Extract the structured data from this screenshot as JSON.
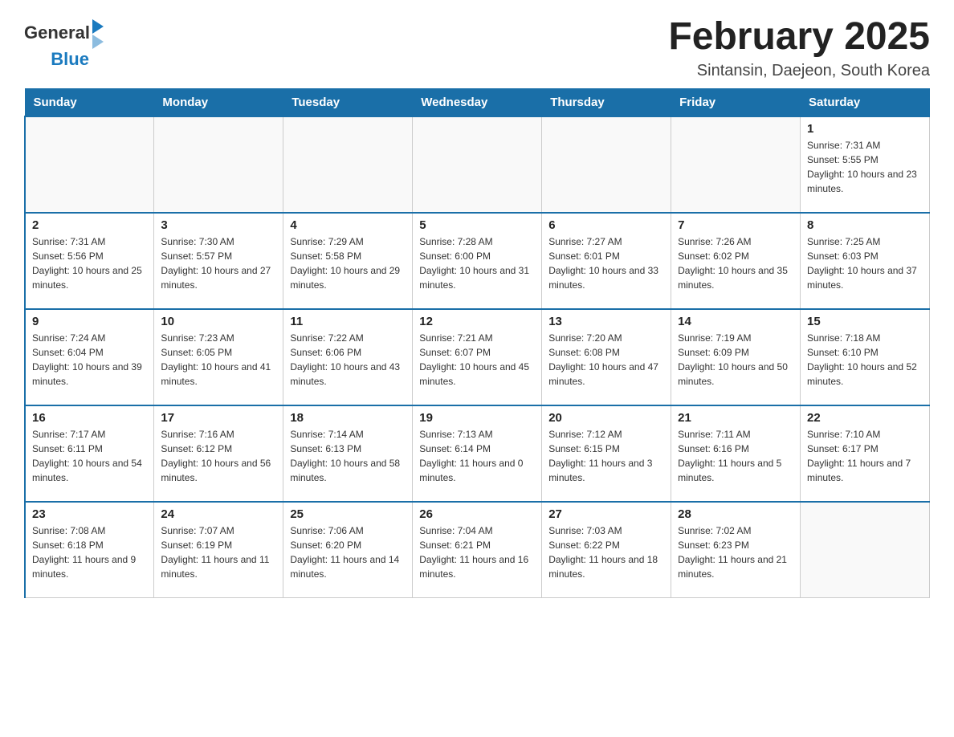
{
  "logo": {
    "text_general": "General",
    "text_blue": "Blue"
  },
  "title": "February 2025",
  "location": "Sintansin, Daejeon, South Korea",
  "days_of_week": [
    "Sunday",
    "Monday",
    "Tuesday",
    "Wednesday",
    "Thursday",
    "Friday",
    "Saturday"
  ],
  "weeks": [
    [
      {
        "day": "",
        "info": ""
      },
      {
        "day": "",
        "info": ""
      },
      {
        "day": "",
        "info": ""
      },
      {
        "day": "",
        "info": ""
      },
      {
        "day": "",
        "info": ""
      },
      {
        "day": "",
        "info": ""
      },
      {
        "day": "1",
        "info": "Sunrise: 7:31 AM\nSunset: 5:55 PM\nDaylight: 10 hours and 23 minutes."
      }
    ],
    [
      {
        "day": "2",
        "info": "Sunrise: 7:31 AM\nSunset: 5:56 PM\nDaylight: 10 hours and 25 minutes."
      },
      {
        "day": "3",
        "info": "Sunrise: 7:30 AM\nSunset: 5:57 PM\nDaylight: 10 hours and 27 minutes."
      },
      {
        "day": "4",
        "info": "Sunrise: 7:29 AM\nSunset: 5:58 PM\nDaylight: 10 hours and 29 minutes."
      },
      {
        "day": "5",
        "info": "Sunrise: 7:28 AM\nSunset: 6:00 PM\nDaylight: 10 hours and 31 minutes."
      },
      {
        "day": "6",
        "info": "Sunrise: 7:27 AM\nSunset: 6:01 PM\nDaylight: 10 hours and 33 minutes."
      },
      {
        "day": "7",
        "info": "Sunrise: 7:26 AM\nSunset: 6:02 PM\nDaylight: 10 hours and 35 minutes."
      },
      {
        "day": "8",
        "info": "Sunrise: 7:25 AM\nSunset: 6:03 PM\nDaylight: 10 hours and 37 minutes."
      }
    ],
    [
      {
        "day": "9",
        "info": "Sunrise: 7:24 AM\nSunset: 6:04 PM\nDaylight: 10 hours and 39 minutes."
      },
      {
        "day": "10",
        "info": "Sunrise: 7:23 AM\nSunset: 6:05 PM\nDaylight: 10 hours and 41 minutes."
      },
      {
        "day": "11",
        "info": "Sunrise: 7:22 AM\nSunset: 6:06 PM\nDaylight: 10 hours and 43 minutes."
      },
      {
        "day": "12",
        "info": "Sunrise: 7:21 AM\nSunset: 6:07 PM\nDaylight: 10 hours and 45 minutes."
      },
      {
        "day": "13",
        "info": "Sunrise: 7:20 AM\nSunset: 6:08 PM\nDaylight: 10 hours and 47 minutes."
      },
      {
        "day": "14",
        "info": "Sunrise: 7:19 AM\nSunset: 6:09 PM\nDaylight: 10 hours and 50 minutes."
      },
      {
        "day": "15",
        "info": "Sunrise: 7:18 AM\nSunset: 6:10 PM\nDaylight: 10 hours and 52 minutes."
      }
    ],
    [
      {
        "day": "16",
        "info": "Sunrise: 7:17 AM\nSunset: 6:11 PM\nDaylight: 10 hours and 54 minutes."
      },
      {
        "day": "17",
        "info": "Sunrise: 7:16 AM\nSunset: 6:12 PM\nDaylight: 10 hours and 56 minutes."
      },
      {
        "day": "18",
        "info": "Sunrise: 7:14 AM\nSunset: 6:13 PM\nDaylight: 10 hours and 58 minutes."
      },
      {
        "day": "19",
        "info": "Sunrise: 7:13 AM\nSunset: 6:14 PM\nDaylight: 11 hours and 0 minutes."
      },
      {
        "day": "20",
        "info": "Sunrise: 7:12 AM\nSunset: 6:15 PM\nDaylight: 11 hours and 3 minutes."
      },
      {
        "day": "21",
        "info": "Sunrise: 7:11 AM\nSunset: 6:16 PM\nDaylight: 11 hours and 5 minutes."
      },
      {
        "day": "22",
        "info": "Sunrise: 7:10 AM\nSunset: 6:17 PM\nDaylight: 11 hours and 7 minutes."
      }
    ],
    [
      {
        "day": "23",
        "info": "Sunrise: 7:08 AM\nSunset: 6:18 PM\nDaylight: 11 hours and 9 minutes."
      },
      {
        "day": "24",
        "info": "Sunrise: 7:07 AM\nSunset: 6:19 PM\nDaylight: 11 hours and 11 minutes."
      },
      {
        "day": "25",
        "info": "Sunrise: 7:06 AM\nSunset: 6:20 PM\nDaylight: 11 hours and 14 minutes."
      },
      {
        "day": "26",
        "info": "Sunrise: 7:04 AM\nSunset: 6:21 PM\nDaylight: 11 hours and 16 minutes."
      },
      {
        "day": "27",
        "info": "Sunrise: 7:03 AM\nSunset: 6:22 PM\nDaylight: 11 hours and 18 minutes."
      },
      {
        "day": "28",
        "info": "Sunrise: 7:02 AM\nSunset: 6:23 PM\nDaylight: 11 hours and 21 minutes."
      },
      {
        "day": "",
        "info": ""
      }
    ]
  ]
}
